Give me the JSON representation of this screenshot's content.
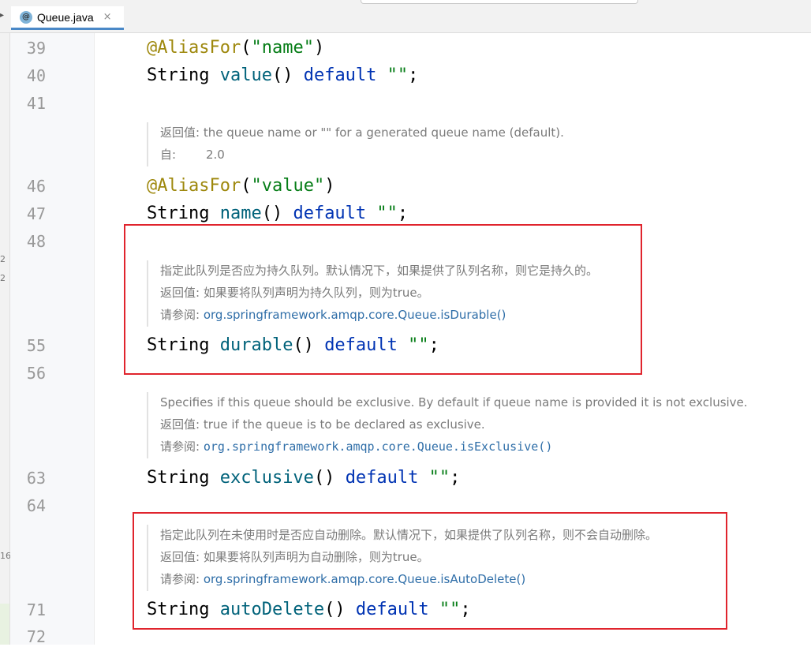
{
  "editor": {
    "tab": {
      "icon": "@",
      "label": "Queue.java",
      "close": "×"
    },
    "left_edge_marks": [
      "2",
      "2",
      "16"
    ]
  },
  "line_numbers": [
    "39",
    "40",
    "41",
    "46",
    "47",
    "48",
    "55",
    "56",
    "63",
    "64",
    "71",
    "72"
  ],
  "code": {
    "l39": {
      "ann": "@AliasFor",
      "paren_open": "(",
      "str": "\"name\"",
      "paren_close": ")"
    },
    "l40": {
      "type": "String ",
      "method": "value",
      "rest": "() ",
      "kw": "default",
      "sp": " ",
      "str": "\"\"",
      "end": ";"
    },
    "l46": {
      "ann": "@AliasFor",
      "paren_open": "(",
      "str": "\"value\"",
      "paren_close": ")"
    },
    "l47": {
      "type": "String ",
      "method": "name",
      "rest": "() ",
      "kw": "default",
      "sp": " ",
      "str": "\"\"",
      "end": ";"
    },
    "l55": {
      "type": "String ",
      "method": "durable",
      "rest": "() ",
      "kw": "default",
      "sp": " ",
      "str": "\"\"",
      "end": ";"
    },
    "l63": {
      "type": "String ",
      "method": "exclusive",
      "rest": "() ",
      "kw": "default",
      "sp": " ",
      "str": "\"\"",
      "end": ";"
    },
    "l71": {
      "type": "String ",
      "method": "autoDelete",
      "rest": "() ",
      "kw": "default",
      "sp": " ",
      "str": "\"\"",
      "end": ";"
    }
  },
  "docs": {
    "value": {
      "returns_label": "返回值:",
      "returns_text": " the queue name or \"\" for a generated queue name (default).",
      "since_label": "自:",
      "since_text": "2.0"
    },
    "durable": {
      "desc": "指定此队列是否应为持久队列。默认情况下，如果提供了队列名称，则它是持久的。",
      "returns_label": "返回值:",
      "returns_text": " 如果要将队列声明为持久队列，则为true。",
      "see_label": "请参阅:",
      "see_link": "org.springframework.amqp.core.Queue.isDurable()"
    },
    "exclusive": {
      "desc": "Specifies if this queue should be exclusive. By default if queue name is provided it is not exclusive.",
      "returns_label": "返回值:",
      "returns_text": " true if the queue is to be declared as exclusive.",
      "see_label": "请参阅:",
      "see_link": "org.springframework.amqp.core.Queue.isExclusive()"
    },
    "autodelete": {
      "desc": "指定此队列在未使用时是否应自动删除。默认情况下，如果提供了队列名称，则不会自动删除。",
      "returns_label": "返回值:",
      "returns_text": " 如果要将队列声明为自动删除，则为true。",
      "see_label": "请参阅:",
      "see_link": "org.springframework.amqp.core.Queue.isAutoDelete()"
    }
  },
  "colors": {
    "annotation": "#9e880d",
    "string": "#067d17",
    "keyword": "#0033b3",
    "method": "#00627a",
    "highlight_box": "#e0242d",
    "link": "#2f6ea8"
  }
}
